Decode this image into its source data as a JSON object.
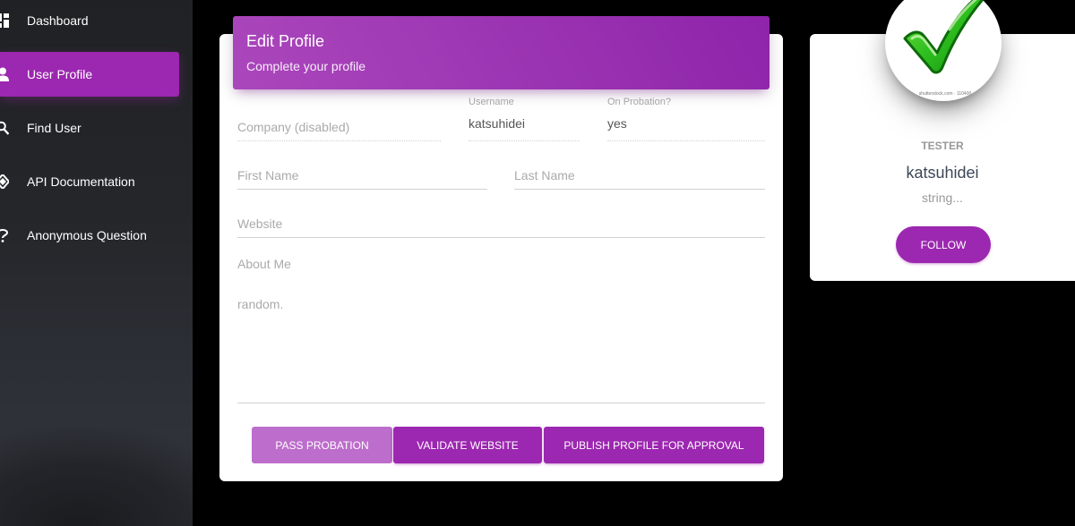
{
  "sidebar": {
    "items": [
      {
        "label": "Dashboard",
        "icon": "dashboard-icon"
      },
      {
        "label": "User Profile",
        "icon": "person-icon",
        "active": true
      },
      {
        "label": "Find User",
        "icon": "search-icon"
      },
      {
        "label": "API Documentation",
        "icon": "code-icon"
      },
      {
        "label": "Anonymous Question",
        "icon": "help-icon"
      }
    ]
  },
  "edit_profile": {
    "title": "Edit Profile",
    "subtitle": "Complete your profile",
    "fields": {
      "company": {
        "placeholder": "Company (disabled)"
      },
      "username": {
        "label": "Username",
        "value": "katsuhidei"
      },
      "probation": {
        "label": "On Probation?",
        "value": "yes"
      },
      "first_name": {
        "placeholder": "First Name"
      },
      "last_name": {
        "placeholder": "Last Name"
      },
      "website": {
        "placeholder": "Website"
      },
      "about": {
        "label": "About Me",
        "value": "random."
      }
    },
    "buttons": {
      "pass_probation": "PASS PROBATION",
      "validate_website": "VALIDATE WEBSITE",
      "publish_profile": "PUBLISH PROFILE FOR APPROVAL"
    }
  },
  "profile_card": {
    "avatar_icon": "checkmark-icon",
    "avatar_caption": "shutterstock.com · 110400",
    "role": "TESTER",
    "name": "katsuhidei",
    "description": "string...",
    "follow_label": "FOLLOW"
  },
  "colors": {
    "accent": "#9c27b0",
    "accent_light": "#bd6dcb",
    "background": "#000000",
    "card": "#ffffff"
  }
}
